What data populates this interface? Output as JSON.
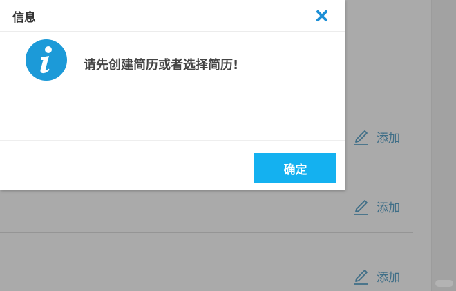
{
  "dialog": {
    "title": "信息",
    "message": "请先创建简历或者选择简历!",
    "confirm_label": "确定",
    "close_icon": "close-icon",
    "info_icon": "info-icon"
  },
  "background": {
    "rows": [
      {
        "action_label": "添加"
      },
      {
        "action_label": "添加"
      },
      {
        "action_label": "添加"
      }
    ]
  },
  "colors": {
    "accent": "#14b1f0",
    "info_icon_fill": "#1c9ad8",
    "close_icon": "#1c8fd6",
    "link_text": "#3f6e87",
    "overlay": "#aaaaaa"
  }
}
